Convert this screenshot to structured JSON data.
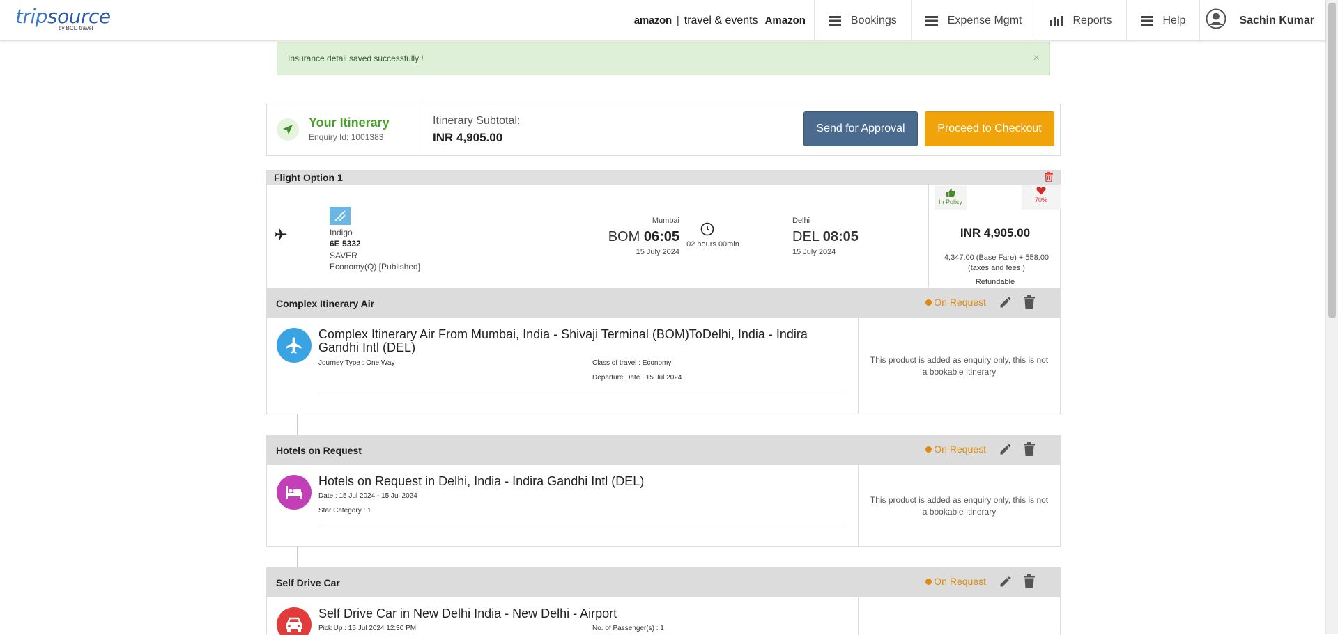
{
  "header": {
    "logo_trip": "trip",
    "logo_source": "source",
    "logo_sub": "by BCD travel",
    "brand_amazon": "amazon",
    "brand_travel": "travel & events",
    "brand_account": "Amazon",
    "nav": [
      {
        "label": "Bookings",
        "icon": "menu-icon"
      },
      {
        "label": "Expense Mgmt",
        "icon": "menu-icon"
      },
      {
        "label": "Reports",
        "icon": "bar-chart-icon"
      },
      {
        "label": "Help",
        "icon": "menu-icon"
      }
    ],
    "user_name": "Sachin Kumar"
  },
  "alert": {
    "message": "Insurance detail saved successfully !",
    "close": "×"
  },
  "itinerary": {
    "title": "Your Itinerary",
    "enquiry": "Enquiry Id: 1001383",
    "subtotal_label": "Itinerary Subtotal:",
    "subtotal_value": "INR  4,905.00",
    "send_approval": "Send for Approval",
    "checkout": "Proceed to Checkout"
  },
  "flight": {
    "header": "Flight Option 1",
    "airline": "Indigo",
    "flight_no": "6E 5332",
    "fare_type": "SAVER",
    "cabin": "Economy(Q) [Published]",
    "dep_city": "Mumbai",
    "dep_code": "BOM",
    "dep_time": "06:05",
    "dep_date": "15 July 2024",
    "duration": "02 hours 00min",
    "arr_city": "Delhi",
    "arr_code": "DEL",
    "arr_time": "08:05",
    "arr_date": "15 July 2024",
    "policy": "In Policy",
    "score": "70%",
    "price": "INR 4,905.00",
    "breakdown": "4,347.00 (Base Fare) + 558.00 (taxes and fees )",
    "refundable": "Refundable"
  },
  "sections": [
    {
      "header": "Complex Itinerary Air",
      "status": "On Request",
      "title": "Complex Itinerary Air From Mumbai, India - Shivaji Terminal (BOM)ToDelhi, India - Indira Gandhi Intl (DEL)",
      "meta_left": [
        "Journey Type : One Way"
      ],
      "meta_right": [
        "Class of travel : Economy",
        "Departure Date : 15 Jul 2024"
      ],
      "note": "This product is added as enquiry only, this is not a bookable Itinerary",
      "color": "#3aa3e3"
    },
    {
      "header": "Hotels on Request",
      "status": "On Request",
      "title": "Hotels on Request in Delhi, India - Indira Gandhi Intl (DEL)",
      "meta_left": [
        "Date : 15 Jul 2024 - 15 Jul 2024",
        "Star Category : 1"
      ],
      "meta_right": [],
      "note": "This product is added as enquiry only, this is not a bookable Itinerary",
      "color": "#c23fb8"
    },
    {
      "header": "Self Drive Car",
      "status": "On Request",
      "title": "Self Drive Car in New Delhi India - New Delhi - Airport",
      "meta_left": [
        "Pick Up : 15 Jul 2024 12:30 PM"
      ],
      "meta_right": [
        "No. of Passenger(s) : 1"
      ],
      "note": "",
      "color": "#e23b3b"
    }
  ]
}
